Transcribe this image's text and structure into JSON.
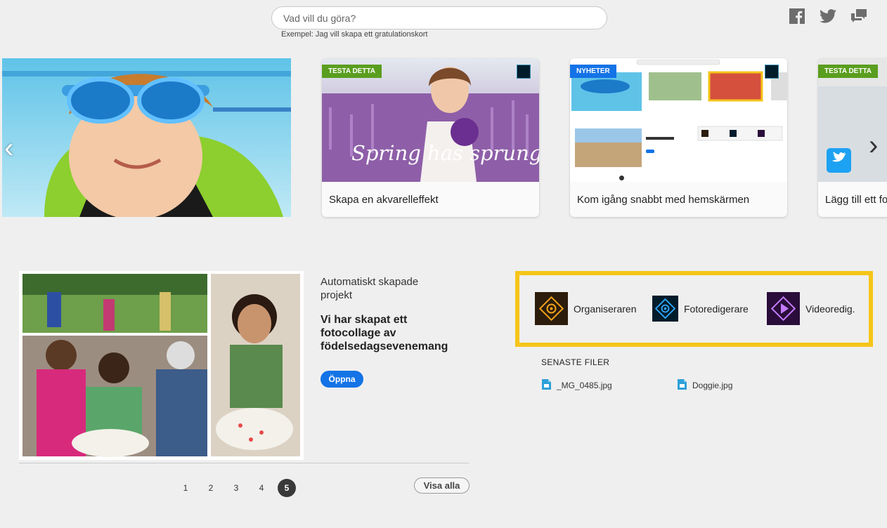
{
  "search": {
    "placeholder": "Vad vill du göra?",
    "hint": "Exempel: Jag vill skapa ett gratulationskort"
  },
  "social": [
    {
      "name": "facebook-icon"
    },
    {
      "name": "twitter-icon"
    },
    {
      "name": "feedback-icon"
    }
  ],
  "carousel": {
    "cards": [
      {
        "badge": "TESTA DETTA",
        "title": "Skapa en akvarelleffekt",
        "overlay_text": "Spring has sprung!"
      },
      {
        "badge": "NYHETER",
        "title": "Kom igång snabbt med hemskärmen"
      },
      {
        "badge": "TESTA DETTA",
        "title": "Lägg till ett fo"
      }
    ]
  },
  "project": {
    "subtitle": "Automatiskt skapade projekt",
    "title": "Vi har skapat ett fotocollage av födelsedagsevenemang",
    "open_label": "Öppna",
    "pages": [
      "1",
      "2",
      "3",
      "4",
      "5"
    ],
    "active_page": "5",
    "view_all_label": "Visa alla"
  },
  "apps": [
    {
      "label": "Organiseraren",
      "icon": "organizer-icon"
    },
    {
      "label": "Fotoredigerare",
      "icon": "photo-editor-icon"
    },
    {
      "label": "Videoredig.",
      "icon": "video-editor-icon"
    }
  ],
  "recent": {
    "heading": "SENASTE FILER",
    "files": [
      {
        "name": "_MG_0485.jpg"
      },
      {
        "name": "Doggie.jpg"
      }
    ]
  },
  "colors": {
    "accent_blue": "#1473e6",
    "badge_green": "#5a9e1f",
    "highlight_yellow": "#f5c518"
  }
}
